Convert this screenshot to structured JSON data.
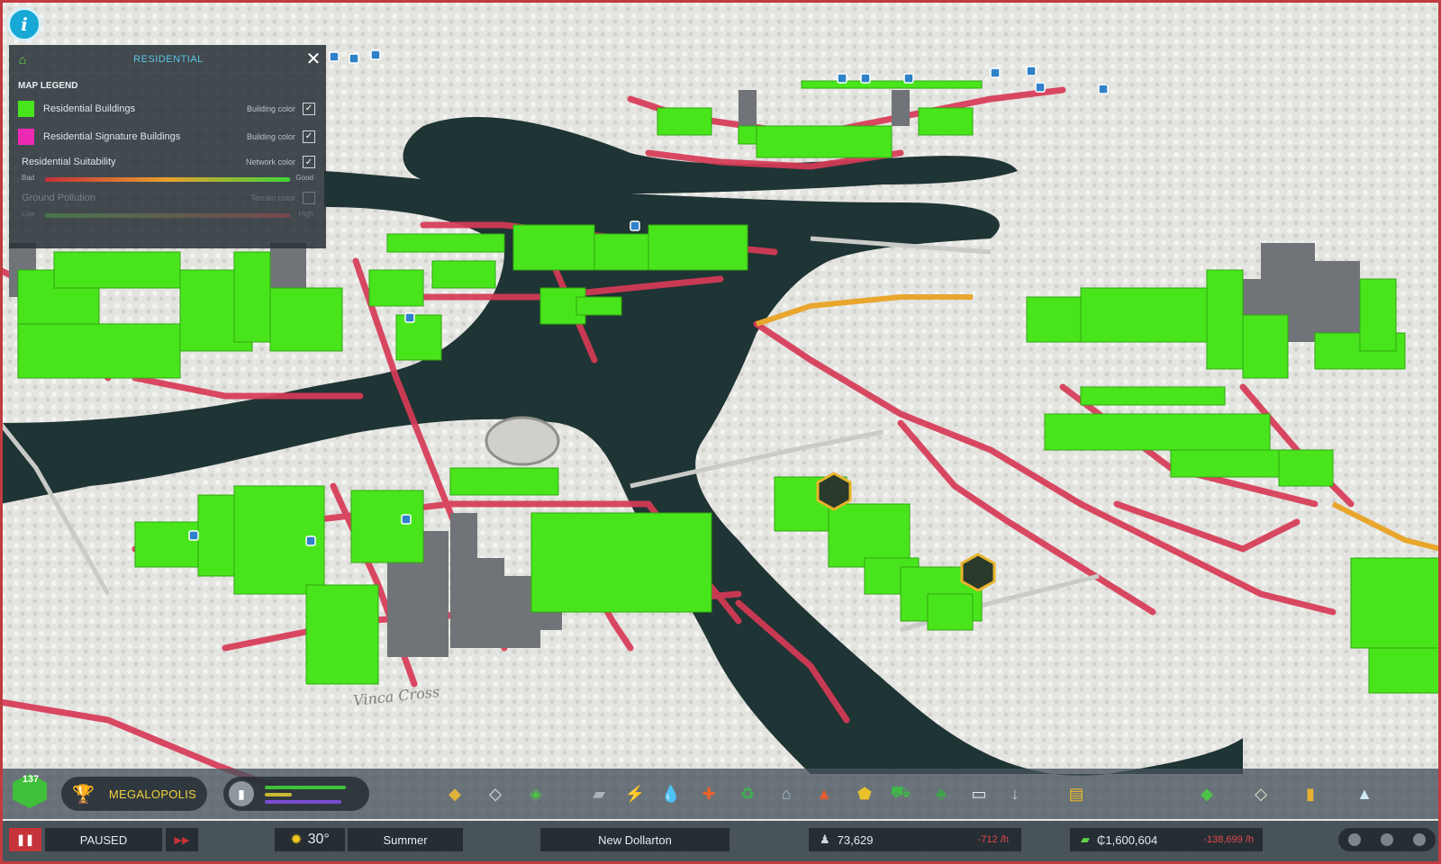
{
  "colors": {
    "residential": "#49e51c",
    "signature": "#ee2ab5",
    "road": "#d73a56",
    "accent": "#17a8d6",
    "negative": "#e5484d"
  },
  "info_button": {
    "icon": "info-icon",
    "label": "i"
  },
  "legend": {
    "title": "RESIDENTIAL",
    "header_icon": "residential-icon",
    "section": "MAP LEGEND",
    "rows": [
      {
        "label": "Residential Buildings",
        "option": "Building color",
        "checked": true
      },
      {
        "label": "Residential Signature Buildings",
        "option": "Building color",
        "checked": true
      },
      {
        "label": "Residential Suitability",
        "option": "Network color",
        "checked": true,
        "low": "Bad",
        "high": "Good"
      },
      {
        "label": "Ground Pollution",
        "option": "Terrain color",
        "checked": false,
        "low": "Low",
        "high": "High"
      }
    ],
    "check_glyph": "✓",
    "close_glyph": "✕"
  },
  "toolbar": {
    "population_level": "137",
    "milestone": "MEGALOPOLIS",
    "demand_bars": [
      {
        "color": "#3fc23a",
        "value": 0.9
      },
      {
        "color": "#c9b935",
        "value": 0.3
      },
      {
        "color": "#7b4bd1",
        "value": 0.85
      }
    ],
    "tools": [
      {
        "name": "zoning-tool-icon",
        "glyph": "◆",
        "color": "#e0b33c"
      },
      {
        "name": "areas-tool-icon",
        "glyph": "◇",
        "color": "#d8e4ea"
      },
      {
        "name": "parks-tool-icon",
        "glyph": "◈",
        "color": "#4cc247"
      },
      {
        "name": "roads-tool-icon",
        "glyph": "▰",
        "color": "#aab2b6"
      },
      {
        "name": "electricity-icon",
        "glyph": "⚡",
        "color": "#f0c51d"
      },
      {
        "name": "water-icon",
        "glyph": "💧",
        "color": "#3aa3e8"
      },
      {
        "name": "health-icon",
        "glyph": "✚",
        "color": "#e8622c"
      },
      {
        "name": "garbage-icon",
        "glyph": "♻",
        "color": "#38b54a"
      },
      {
        "name": "education-icon",
        "glyph": "⌂",
        "color": "#a7b7c5"
      },
      {
        "name": "fire-icon",
        "glyph": "▲",
        "color": "#e45a2c"
      },
      {
        "name": "police-icon",
        "glyph": "⬟",
        "color": "#e8c02a"
      },
      {
        "name": "transport-icon",
        "glyph": "⛟",
        "color": "#41b64b"
      },
      {
        "name": "landscaping-icon",
        "glyph": "♣",
        "color": "#3ea74a"
      },
      {
        "name": "communications-icon",
        "glyph": "▭",
        "color": "#e7eef2"
      },
      {
        "name": "terraform-icon",
        "glyph": "↓",
        "color": "#c8d0d5"
      },
      {
        "name": "industry-icon",
        "glyph": "▤",
        "color": "#e7bb2b"
      },
      {
        "name": "city-services-icon",
        "glyph": "◆",
        "color": "#4cc247"
      },
      {
        "name": "map-icon",
        "glyph": "◇",
        "color": "#d6e5c2"
      },
      {
        "name": "statistics-icon",
        "glyph": "▮",
        "color": "#e9b233"
      },
      {
        "name": "info-views-icon",
        "glyph": "▲",
        "color": "#cfe9f5"
      }
    ]
  },
  "status": {
    "pause_glyph": "❚❚",
    "paused": "PAUSED",
    "speed_glyph": "▶▶",
    "temperature": "30°",
    "season": "Summer",
    "city_name": "New Dollarton",
    "population": "73,629",
    "population_delta": "-712 /h",
    "money": "₵1,600,604",
    "money_delta": "-138,699 /h"
  },
  "district_label": "Vinca Cross"
}
